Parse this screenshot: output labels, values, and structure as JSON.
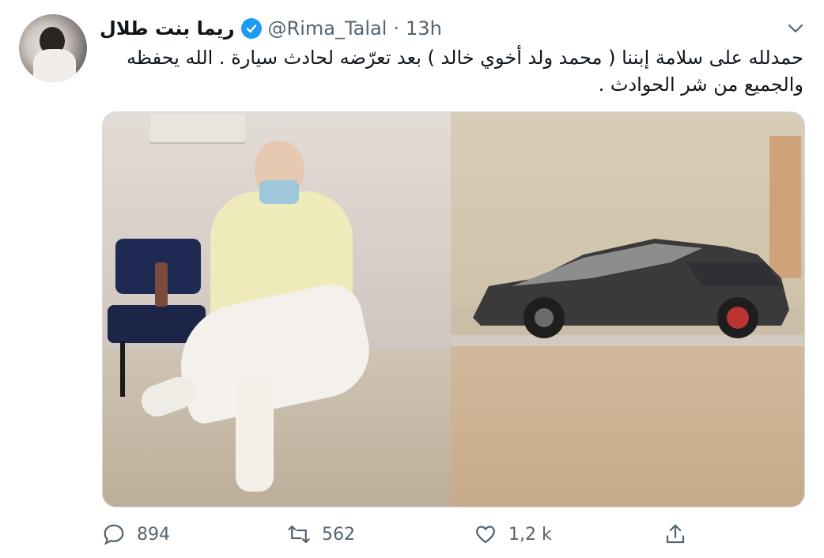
{
  "tweet": {
    "author_name": "ريما بنت طلال",
    "handle": "@Rima_Talal",
    "separator": "·",
    "time": "13h",
    "text_line1": "حمدلله على سلامة إبننا ( محمد ولد أخوي خالد ) بعد تعرّضه لحادث سيارة . الله يحفظه",
    "text_line2": "والجميع من شر الحوادث .",
    "verified": true
  },
  "media": {
    "photo_count": 2
  },
  "actions": {
    "reply_count": "894",
    "retweet_count": "562",
    "like_count": "1,2 k"
  },
  "colors": {
    "verified_blue": "#1d9bf0",
    "secondary_text": "#536471",
    "primary_text": "#0f1419"
  },
  "icons": {
    "menu": "chevron-down-icon",
    "verified": "verified-badge-icon",
    "reply": "reply-icon",
    "retweet": "retweet-icon",
    "like": "heart-icon",
    "share": "share-icon"
  }
}
